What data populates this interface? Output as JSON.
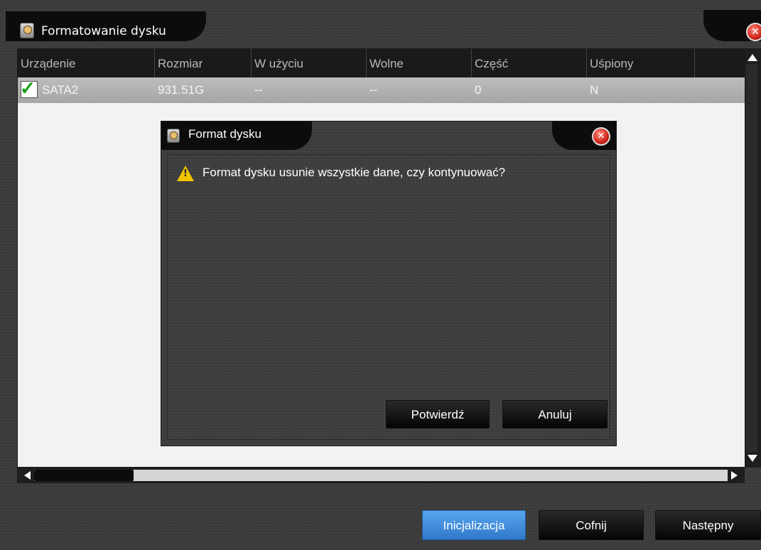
{
  "window": {
    "title": "Formatowanie dysku"
  },
  "table": {
    "columns": [
      "Urządenie",
      "Rozmiar",
      "W użyciu",
      "Wolne",
      "Część",
      "Uśpiony"
    ],
    "rows": [
      {
        "device": "SATA2",
        "size": "931.51G",
        "used": "--",
        "free": "--",
        "part": "0",
        "sleep": "N",
        "checked": true
      }
    ]
  },
  "buttons": {
    "init": "Inicjalizacja",
    "back": "Cofnij",
    "next": "Następny"
  },
  "dialog": {
    "title": "Format dysku",
    "message": "Format dysku usunie wszystkie dane, czy kontynuować?",
    "confirm": "Potwierdź",
    "cancel": "Anuluj"
  },
  "colors": {
    "accent": "#3d8ee0",
    "check": "#14a014",
    "close": "#d0241a",
    "warning": "#f2c400"
  }
}
